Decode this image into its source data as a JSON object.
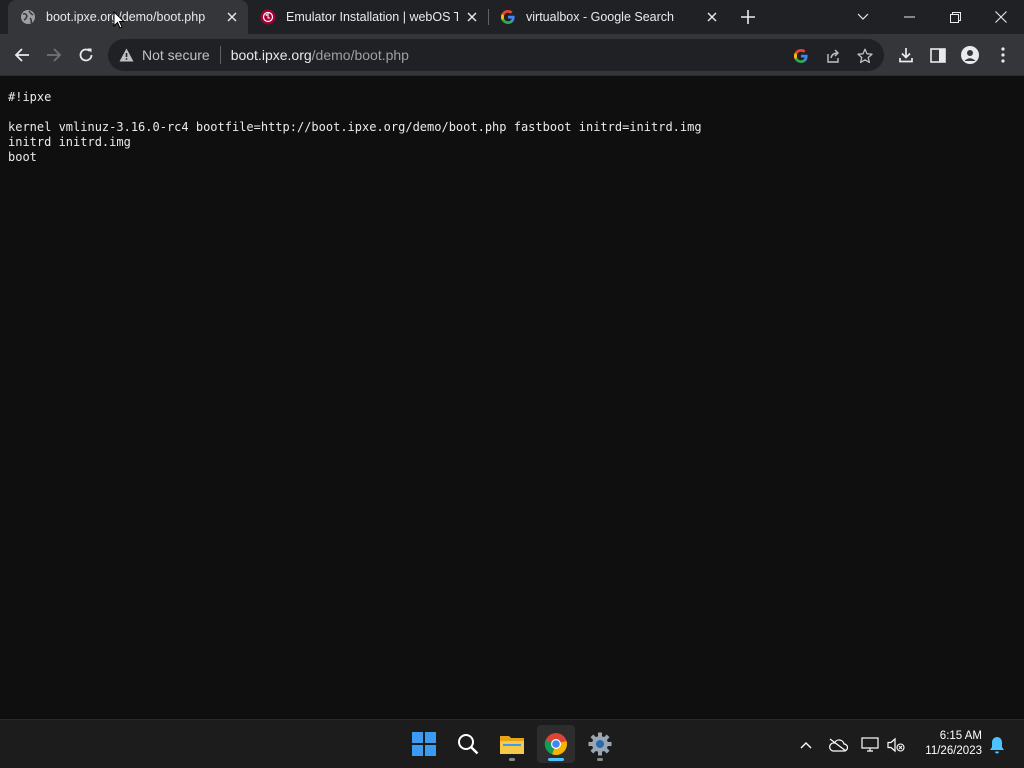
{
  "browser": {
    "tabs": [
      {
        "title": "boot.ipxe.org/demo/boot.php",
        "favicon": "globe-icon",
        "active": true
      },
      {
        "title": "Emulator Installation | webOS TV",
        "favicon": "lg-logo-icon",
        "active": false
      },
      {
        "title": "virtualbox - Google Search",
        "favicon": "google-g-icon",
        "active": false
      }
    ],
    "omnibox": {
      "security_label": "Not secure",
      "url_host": "boot.ipxe.org",
      "url_path": "/demo/boot.php"
    }
  },
  "page": {
    "content": "#!ipxe\n\nkernel vmlinuz-3.16.0-rc4 bootfile=http://boot.ipxe.org/demo/boot.php fastboot initrd=initrd.img\ninitrd initrd.img\nboot"
  },
  "taskbar": {
    "apps": [
      "windows-start-icon",
      "search-icon",
      "file-explorer-icon",
      "chrome-icon",
      "settings-gear-icon"
    ],
    "active_app": "chrome-icon",
    "clock": {
      "time": "6:15 AM",
      "date": "11/26/2023"
    }
  },
  "colors": {
    "tab_strip": "#202124",
    "toolbar": "#35363a",
    "omnibox": "#202124",
    "page_bg": "#0f0f0f",
    "taskbar": "#1c1c1c",
    "accent": "#4cc2ff"
  }
}
